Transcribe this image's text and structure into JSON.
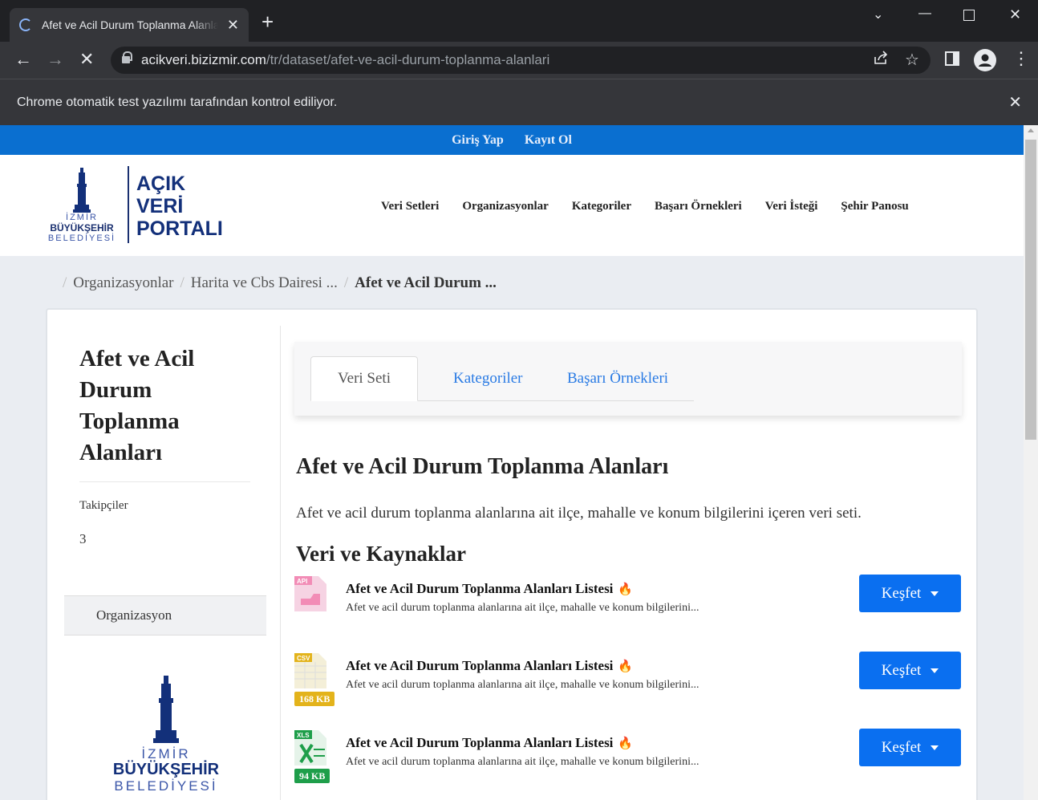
{
  "browser": {
    "tab_title": "Afet ve Acil Durum Toplanma Alanları",
    "url_domain": "acikveri.bizizmir.com",
    "url_path": "/tr/dataset/afet-ve-acil-durum-toplanma-alanlari",
    "infobar_text": "Chrome otomatik test yazılımı tarafından kontrol ediliyor."
  },
  "topbar": {
    "login": "Giriş Yap",
    "register": "Kayıt Ol"
  },
  "logo": {
    "city_line1": "İZMİR",
    "city_line2": "BÜYÜKŞEHİR",
    "city_line3": "BELEDİYESİ",
    "portal_line1": "AÇIK",
    "portal_line2": "VERİ",
    "portal_line3": "PORTALI"
  },
  "nav": [
    "Veri Setleri",
    "Organizasyonlar",
    "Kategoriler",
    "Başarı Örnekleri",
    "Veri İsteği",
    "Şehir Panosu"
  ],
  "breadcrumb": [
    "Organizasyonlar",
    "Harita ve Cbs Dairesi ...",
    "Afet ve Acil Durum ..."
  ],
  "sidebar": {
    "title": "Afet ve Acil Durum Toplanma Alanları",
    "followers_label": "Takipçiler",
    "followers_count": "3",
    "org_label": "Organizasyon",
    "org_logo_line1": "İZMİR",
    "org_logo_line2": "BÜYÜKŞEHİR",
    "org_logo_line3": "BELEDİYESİ"
  },
  "tabs": [
    "Veri Seti",
    "Kategoriler",
    "Başarı Örnekleri"
  ],
  "dataset": {
    "title": "Afet ve Acil Durum Toplanma Alanları",
    "description": "Afet ve acil durum toplanma alanlarına ait ilçe, mahalle ve konum bilgilerini içeren veri seti.",
    "resources_heading": "Veri ve Kaynaklar"
  },
  "resources": [
    {
      "format": "API",
      "size": "",
      "title": "Afet ve Acil Durum Toplanma Alanları Listesi",
      "desc": "Afet ve acil durum toplanma alanlarına ait ilçe, mahalle ve konum bilgilerini...",
      "button": "Keşfet",
      "color": "#f28cb6"
    },
    {
      "format": "CSV",
      "size": "168 KB",
      "title": "Afet ve Acil Durum Toplanma Alanları Listesi",
      "desc": "Afet ve acil durum toplanma alanlarına ait ilçe, mahalle ve konum bilgilerini...",
      "button": "Keşfet",
      "color": "#e3b31b"
    },
    {
      "format": "XLS",
      "size": "94 KB",
      "title": "Afet ve Acil Durum Toplanma Alanları Listesi",
      "desc": "Afet ve acil durum toplanma alanlarına ait ilçe, mahalle ve konum bilgilerini...",
      "button": "Keşfet",
      "color": "#1e9e4a"
    }
  ]
}
